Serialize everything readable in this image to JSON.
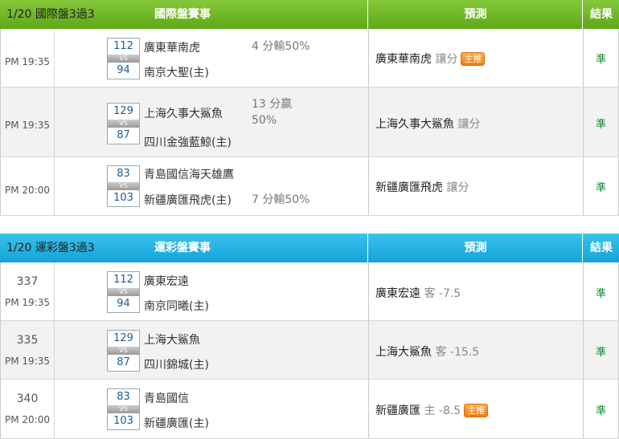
{
  "sections": [
    {
      "date_label": "1/20 國際盤3過3",
      "title": "國際盤賽事",
      "col_prediction": "預測",
      "col_result": "結果",
      "rows": [
        {
          "num": "",
          "time": "PM 19:35",
          "score_away": "112",
          "vs": "VS",
          "score_home": "94",
          "team_away": "廣東華南虎",
          "team_home": "南京大聖(主)",
          "spread": "4 分輸50%",
          "pick": "廣東華南虎",
          "pick_extra": "讓分",
          "badge": "主推",
          "result": "準"
        },
        {
          "num": "",
          "time": "PM 19:35",
          "score_away": "129",
          "vs": "VS",
          "score_home": "87",
          "team_away": "上海久事大鯊魚",
          "team_home": "四川金強藍鯨(主)",
          "spread": "13 分贏 50%",
          "pick": "上海久事大鯊魚",
          "pick_extra": "讓分",
          "badge": "",
          "result": "準"
        },
        {
          "num": "",
          "time": "PM 20:00",
          "score_away": "83",
          "vs": "VS",
          "score_home": "103",
          "team_away": "青島國信海天雄鷹",
          "team_home": "新疆廣匯飛虎(主)",
          "spread": "7 分輸50%",
          "pick": "新疆廣匯飛虎",
          "pick_extra": "讓分",
          "badge": "",
          "result": "準"
        }
      ]
    },
    {
      "date_label": "1/20 運彩盤3過3",
      "title": "運彩盤賽事",
      "col_prediction": "預測",
      "col_result": "結果",
      "rows": [
        {
          "num": "337",
          "time": "PM 19:35",
          "score_away": "112",
          "vs": "VS",
          "score_home": "94",
          "team_away": "廣東宏遠",
          "team_home": "南京同曦(主)",
          "spread": "",
          "pick": "廣東宏遠",
          "pick_extra": "客 -7.5",
          "badge": "",
          "result": "準"
        },
        {
          "num": "335",
          "time": "PM 19:35",
          "score_away": "129",
          "vs": "VS",
          "score_home": "87",
          "team_away": "上海大鯊魚",
          "team_home": "四川錦城(主)",
          "spread": "",
          "pick": "上海大鯊魚",
          "pick_extra": "客 -15.5",
          "badge": "",
          "result": "準"
        },
        {
          "num": "340",
          "time": "PM 20:00",
          "score_away": "83",
          "vs": "VS",
          "score_home": "103",
          "team_away": "青島國信",
          "team_home": "新疆廣匯(主)",
          "spread": "",
          "pick": "新疆廣匯",
          "pick_extra": "主 -8.5",
          "badge": "主推",
          "result": "準"
        }
      ]
    }
  ],
  "colors": {
    "green_header": "#6cb42a",
    "blue_header": "#1fb0e2",
    "result_green": "#0a8a2c",
    "badge_orange": "#f58a1f"
  }
}
